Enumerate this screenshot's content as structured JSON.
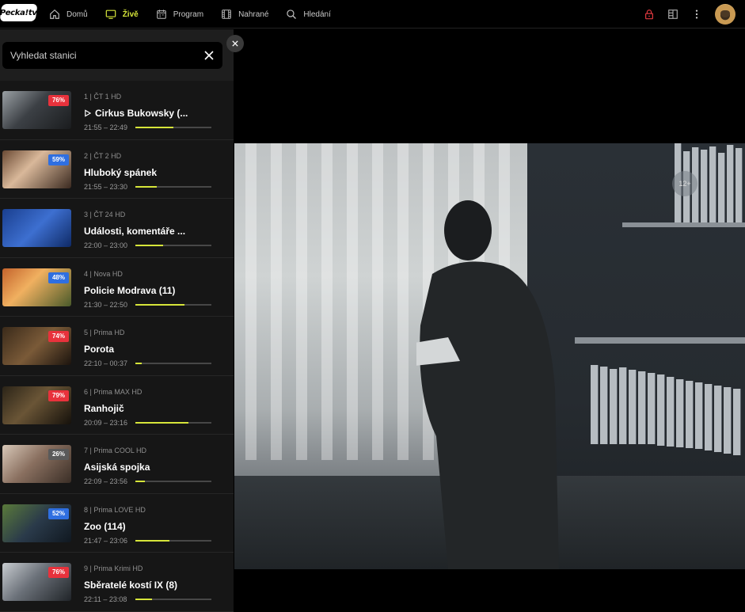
{
  "header": {
    "logo_text": "Pecka!tv",
    "nav": [
      {
        "label": "Domů",
        "icon": "home-icon",
        "active": false
      },
      {
        "label": "Živě",
        "icon": "tv-icon",
        "active": true
      },
      {
        "label": "Program",
        "icon": "calendar-icon",
        "active": false
      },
      {
        "label": "Nahrané",
        "icon": "film-icon",
        "active": false
      },
      {
        "label": "Hledání",
        "icon": "search-icon",
        "active": false
      }
    ],
    "right_icons": [
      "lock-icon",
      "layout-icon",
      "more-vertical-icon",
      "avatar"
    ]
  },
  "colors": {
    "accent": "#d6e53a",
    "badge_red": "#e8323c",
    "badge_blue": "#2f6fe0",
    "badge_gray": "#5a5a5a",
    "lock_red": "#e0393f"
  },
  "sidebar": {
    "search_placeholder": "Vyhledat stanici",
    "channels": [
      {
        "num": "1 | ČT 1 HD",
        "title": "Cirkus Bukowsky (...",
        "time": "21:55 – 22:49",
        "progress": 0.5,
        "badge": "76%",
        "badge_color": "red",
        "playing": true
      },
      {
        "num": "2 | ČT 2 HD",
        "title": "Hluboký spánek",
        "time": "21:55 – 23:30",
        "progress": 0.28,
        "badge": "59%",
        "badge_color": "blue",
        "playing": false
      },
      {
        "num": "3 | ČT 24 HD",
        "title": "Události, komentáře ...",
        "time": "22:00 – 23:00",
        "progress": 0.36,
        "badge": "",
        "badge_color": "",
        "playing": false
      },
      {
        "num": "4 | Nova HD",
        "title": "Policie Modrava (11)",
        "time": "21:30 – 22:50",
        "progress": 0.65,
        "badge": "48%",
        "badge_color": "blue",
        "playing": false
      },
      {
        "num": "5 | Prima HD",
        "title": "Porota",
        "time": "22:10 – 00:37",
        "progress": 0.08,
        "badge": "74%",
        "badge_color": "red",
        "playing": false
      },
      {
        "num": "6 | Prima MAX HD",
        "title": "Ranhojič",
        "time": "20:09 – 23:16",
        "progress": 0.7,
        "badge": "79%",
        "badge_color": "red",
        "playing": false
      },
      {
        "num": "7 | Prima COOL HD",
        "title": "Asijská spojka",
        "time": "22:09 – 23:56",
        "progress": 0.12,
        "badge": "26%",
        "badge_color": "gray",
        "playing": false
      },
      {
        "num": "8 | Prima LOVE HD",
        "title": "Zoo (114)",
        "time": "21:47 – 23:06",
        "progress": 0.45,
        "badge": "52%",
        "badge_color": "blue",
        "playing": false
      },
      {
        "num": "9 | Prima Krimi HD",
        "title": "Sběratelé kostí IX (8)",
        "time": "22:11 – 23:08",
        "progress": 0.22,
        "badge": "76%",
        "badge_color": "red",
        "playing": false
      }
    ]
  },
  "player": {
    "overlay_badge": "12+"
  }
}
